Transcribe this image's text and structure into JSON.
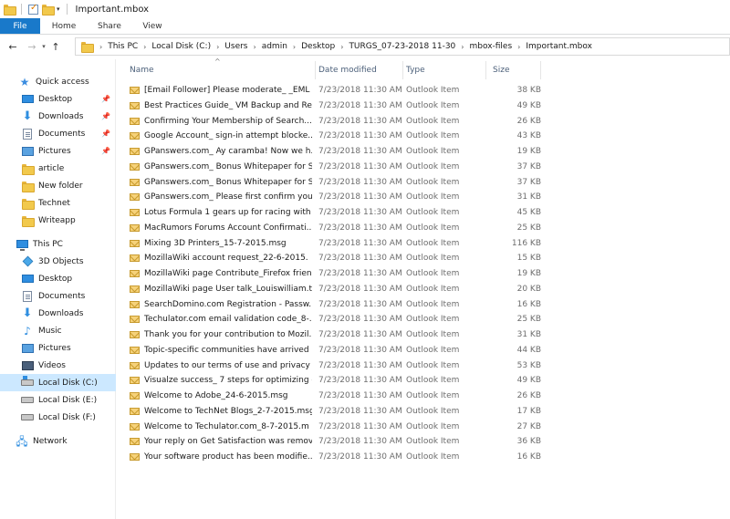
{
  "window": {
    "title": "Important.mbox"
  },
  "ribbon": {
    "tabs": [
      "File",
      "Home",
      "Share",
      "View"
    ]
  },
  "address": {
    "crumbs": [
      "This PC",
      "Local Disk (C:)",
      "Users",
      "admin",
      "Desktop",
      "TURGS_07-23-2018 11-30",
      "mbox-files",
      "Important.mbox"
    ]
  },
  "sidebar": {
    "quick_access": "Quick access",
    "quick_items": [
      "Desktop",
      "Downloads",
      "Documents",
      "Pictures",
      "article",
      "New folder",
      "Technet",
      "Writeapp"
    ],
    "this_pc": "This PC",
    "pc_items": [
      "3D Objects",
      "Desktop",
      "Documents",
      "Downloads",
      "Music",
      "Pictures",
      "Videos",
      "Local Disk (C:)",
      "Local Disk (E:)",
      "Local Disk (F:)"
    ],
    "network": "Network"
  },
  "columns": {
    "name": "Name",
    "date": "Date modified",
    "type": "Type",
    "size": "Size"
  },
  "files": [
    {
      "name": "[Email Follower] Please moderate_ _EML ...",
      "date": "7/23/2018 11:30 AM",
      "type": "Outlook Item",
      "size": "38 KB"
    },
    {
      "name": "Best Practices Guide_ VM Backup and Re...",
      "date": "7/23/2018 11:30 AM",
      "type": "Outlook Item",
      "size": "49 KB"
    },
    {
      "name": "Confirming Your Membership of Search...",
      "date": "7/23/2018 11:30 AM",
      "type": "Outlook Item",
      "size": "26 KB"
    },
    {
      "name": "Google Account_ sign-in attempt blocke...",
      "date": "7/23/2018 11:30 AM",
      "type": "Outlook Item",
      "size": "43 KB"
    },
    {
      "name": "GPanswers.com_ Ay caramba! Now we h...",
      "date": "7/23/2018 11:30 AM",
      "type": "Outlook Item",
      "size": "19 KB"
    },
    {
      "name": "GPanswers.com_ Bonus Whitepaper for S...",
      "date": "7/23/2018 11:30 AM",
      "type": "Outlook Item",
      "size": "37 KB"
    },
    {
      "name": "GPanswers.com_ Bonus Whitepaper for S...",
      "date": "7/23/2018 11:30 AM",
      "type": "Outlook Item",
      "size": "37 KB"
    },
    {
      "name": "GPanswers.com_ Please first confirm you...",
      "date": "7/23/2018 11:30 AM",
      "type": "Outlook Item",
      "size": "31 KB"
    },
    {
      "name": "Lotus Formula 1 gears up for racing with ...",
      "date": "7/23/2018 11:30 AM",
      "type": "Outlook Item",
      "size": "45 KB"
    },
    {
      "name": "MacRumors Forums Account Confirmati...",
      "date": "7/23/2018 11:30 AM",
      "type": "Outlook Item",
      "size": "25 KB"
    },
    {
      "name": "Mixing 3D Printers_15-7-2015.msg",
      "date": "7/23/2018 11:30 AM",
      "type": "Outlook Item",
      "size": "116 KB"
    },
    {
      "name": "MozillaWiki account request_22-6-2015.",
      "date": "7/23/2018 11:30 AM",
      "type": "Outlook Item",
      "size": "15 KB"
    },
    {
      "name": "MozillaWiki page Contribute_Firefox frien...",
      "date": "7/23/2018 11:30 AM",
      "type": "Outlook Item",
      "size": "19 KB"
    },
    {
      "name": "MozillaWiki page User talk_Louiswilliam.t...",
      "date": "7/23/2018 11:30 AM",
      "type": "Outlook Item",
      "size": "20 KB"
    },
    {
      "name": "SearchDomino.com Registration - Passw...",
      "date": "7/23/2018 11:30 AM",
      "type": "Outlook Item",
      "size": "16 KB"
    },
    {
      "name": "Techulator.com email validation code_8-...",
      "date": "7/23/2018 11:30 AM",
      "type": "Outlook Item",
      "size": "25 KB"
    },
    {
      "name": "Thank you for your contribution to Mozil...",
      "date": "7/23/2018 11:30 AM",
      "type": "Outlook Item",
      "size": "31 KB"
    },
    {
      "name": "Topic-specific communities have arrived ...",
      "date": "7/23/2018 11:30 AM",
      "type": "Outlook Item",
      "size": "44 KB"
    },
    {
      "name": "Updates to our terms of use and privacy ...",
      "date": "7/23/2018 11:30 AM",
      "type": "Outlook Item",
      "size": "53 KB"
    },
    {
      "name": "Visualze success_ 7 steps for optimizing d...",
      "date": "7/23/2018 11:30 AM",
      "type": "Outlook Item",
      "size": "49 KB"
    },
    {
      "name": "Welcome to Adobe_24-6-2015.msg",
      "date": "7/23/2018 11:30 AM",
      "type": "Outlook Item",
      "size": "26 KB"
    },
    {
      "name": "Welcome to TechNet Blogs_2-7-2015.msg",
      "date": "7/23/2018 11:30 AM",
      "type": "Outlook Item",
      "size": "17 KB"
    },
    {
      "name": "Welcome to Techulator.com_8-7-2015.m",
      "date": "7/23/2018 11:30 AM",
      "type": "Outlook Item",
      "size": "27 KB"
    },
    {
      "name": "Your reply on Get Satisfaction was remov...",
      "date": "7/23/2018 11:30 AM",
      "type": "Outlook Item",
      "size": "36 KB"
    },
    {
      "name": "Your software product has been modifie...",
      "date": "7/23/2018 11:30 AM",
      "type": "Outlook Item",
      "size": "16 KB"
    }
  ],
  "colors": {
    "file_tab": "#1979ca",
    "selected_nav": "#cce8ff",
    "header_text": "#4c607a"
  }
}
